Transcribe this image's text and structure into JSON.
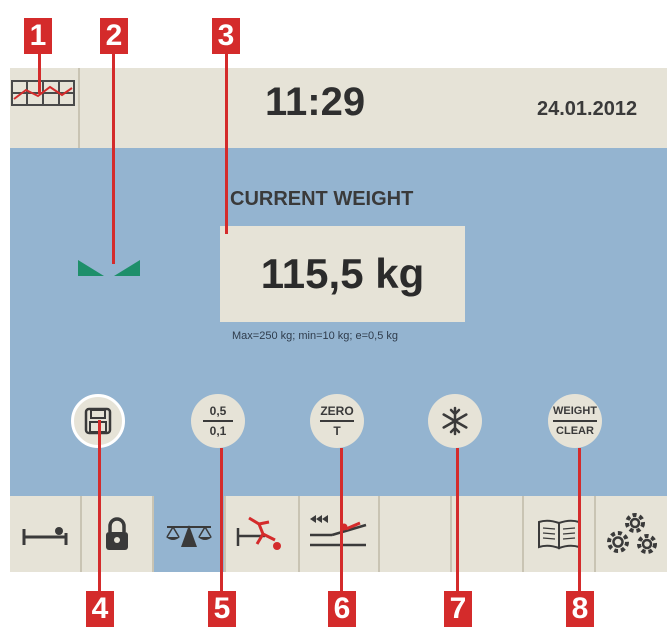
{
  "callouts": [
    "1",
    "2",
    "3",
    "4",
    "5",
    "6",
    "7",
    "8"
  ],
  "header": {
    "clock": "11:29",
    "date": "24.01.2012",
    "chart_icon": "bar-chart-grid-icon"
  },
  "status": {
    "zero_indicator_icon": "green-triangles-zero-icon"
  },
  "weight": {
    "title": "CURRENT WEIGHT",
    "value": "115,5 kg",
    "specs": "Max=250 kg; min=10 kg; e=0,5 kg"
  },
  "round_buttons": {
    "save_icon": "floppy-disk-icon",
    "resolution_top": "0,5",
    "resolution_bottom": "0,1",
    "zero_top": "ZERO",
    "zero_bottom": "T",
    "freeze_icon": "snowflake-icon",
    "weight_top": "WEIGHT",
    "weight_bottom": "CLEAR"
  },
  "toolbar": {
    "items": [
      "bed-patient-icon",
      "lock-icon",
      "scale-balance-icon",
      "patient-fall-alarm-icon",
      "bed-exit-icon",
      "empty-slot",
      "empty-slot",
      "book-icon",
      "gears-icon"
    ]
  },
  "colors": {
    "screen_bg": "#94b4d0",
    "panel_bg": "#e6e3d7",
    "callout_red": "#d42b2b",
    "indicator_green": "#1e8f6a"
  }
}
